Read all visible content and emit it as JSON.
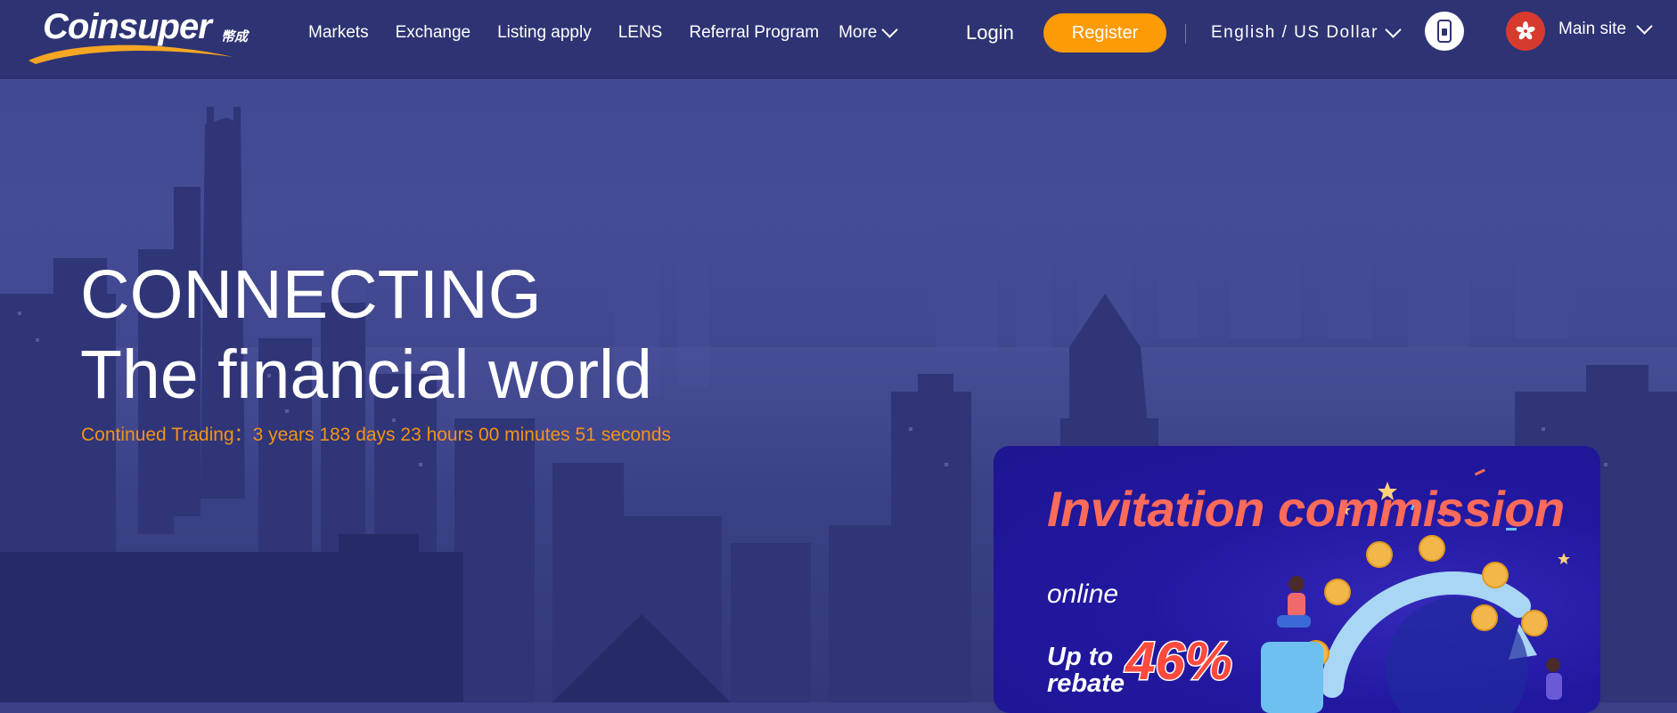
{
  "nav": {
    "logo": {
      "word": "Coinsuper",
      "cn": "幣成"
    },
    "menu": [
      "Markets",
      "Exchange",
      "Listing apply",
      "LENS",
      "Referral Program"
    ],
    "more_label": "More",
    "login_label": "Login",
    "register_label": "Register",
    "language_label": "English / US Dollar",
    "site_label": "Main site",
    "icons": [
      "mobile-phone-icon",
      "hong-kong-flag-icon",
      "chevron-down-icon"
    ]
  },
  "hero": {
    "line1": "CONNECTING",
    "line2": "The financial world",
    "counter": "Continued Trading：3 years 183 days 23 hours 00 minutes 51 seconds"
  },
  "promo": {
    "title": "Invitation commission",
    "subtitle": "online",
    "upto": "Up to",
    "rebate": "rebate",
    "percent": "46%"
  },
  "colors": {
    "nav_bg": "#2e3373",
    "accent": "#fd9b06",
    "counter": "#f39319",
    "promo_title": "#ff6b5a"
  }
}
